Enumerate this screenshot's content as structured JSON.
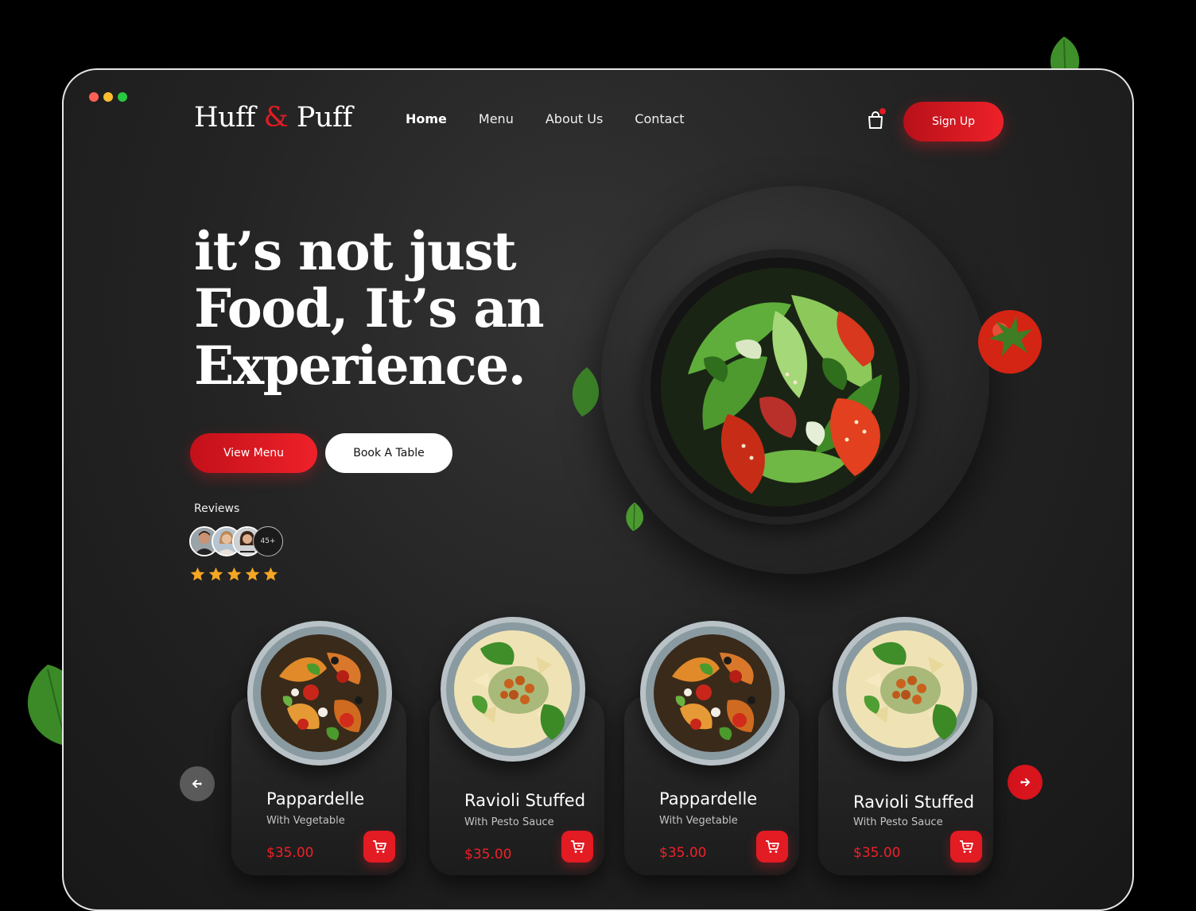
{
  "brand": {
    "name_part1": "Huff",
    "amp": "&",
    "name_part2": "Puff"
  },
  "nav": {
    "items": [
      {
        "label": "Home",
        "active": true
      },
      {
        "label": "Menu",
        "active": false
      },
      {
        "label": "About Us",
        "active": false
      },
      {
        "label": "Contact",
        "active": false
      }
    ]
  },
  "header": {
    "signup_label": "Sign Up",
    "cart_icon": "shopping-bag-icon"
  },
  "hero": {
    "title": "it’s not just\nFood, It’s an\nExperience.",
    "view_menu_label": "View Menu",
    "book_table_label": "Book A Table"
  },
  "reviews": {
    "label": "Reviews",
    "more_count": "45+",
    "rating": 5,
    "max_rating": 5
  },
  "dishes": [
    {
      "name": "Pappardelle",
      "subtitle": "With Vegetable",
      "price": "$35.00",
      "kind": "salad"
    },
    {
      "name": "Ravioli Stuffed",
      "subtitle": "With Pesto Sauce",
      "price": "$35.00",
      "kind": "pasta"
    },
    {
      "name": "Pappardelle",
      "subtitle": "With Vegetable",
      "price": "$35.00",
      "kind": "salad"
    },
    {
      "name": "Ravioli Stuffed",
      "subtitle": "With Pesto Sauce",
      "price": "$35.00",
      "kind": "pasta"
    }
  ],
  "colors": {
    "accent": "#e31b23",
    "background": "#1e1e1e",
    "star": "#f5a623"
  }
}
